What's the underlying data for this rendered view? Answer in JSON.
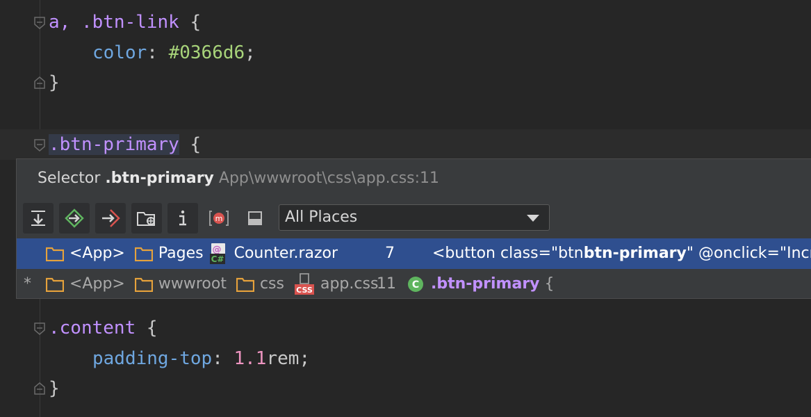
{
  "editor": {
    "lines": [
      {
        "selector": "a, .btn-link",
        "brace": " {"
      },
      {
        "prop": "color",
        "colon": ": ",
        "value": "#0366d6",
        "semi": ";"
      },
      {
        "brace": "}"
      },
      {
        "selector": ".btn-primary",
        "brace": " {"
      },
      {
        "selector": ".content",
        "brace": " {"
      },
      {
        "prop": "padding-top",
        "colon": ": ",
        "num": "1.1",
        "unit": "rem",
        "semi": ";"
      },
      {
        "brace": "}"
      }
    ]
  },
  "popup": {
    "header": {
      "kind": "Selector",
      "name": ".btn-primary",
      "path": "App\\wwwroot\\css\\app.css:11"
    },
    "toolbar": {
      "icons": [
        "pin-to-find-icon",
        "navigate-to-icon",
        "navigate-out-icon",
        "folder-search-icon",
        "info-icon",
        "module-icon",
        "panel-icon"
      ]
    },
    "scope": {
      "selected": "All Places"
    },
    "results": [
      {
        "marker": "",
        "parts": [
          "<App>",
          "Pages"
        ],
        "file": "Counter.razor",
        "line": "7",
        "preview_pre": "<button class=\"btn ",
        "preview_match": "btn-primary",
        "preview_post": "\" @onclick=\"Increr"
      },
      {
        "marker": "*",
        "parts": [
          "<App>",
          "wwwroot",
          "css"
        ],
        "file": "app.css",
        "line": "11",
        "preview_match": ".btn-primary",
        "preview_post": " {"
      }
    ]
  },
  "colors": {
    "selection": "#2f4f8f",
    "folder": "#e6a23c",
    "selector": "#c191ff"
  }
}
